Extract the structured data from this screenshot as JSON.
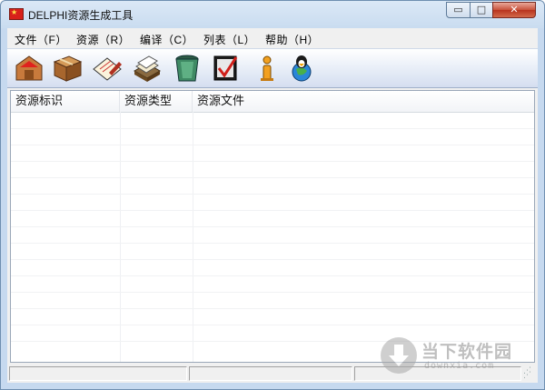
{
  "window": {
    "title": "DELPHI资源生成工具"
  },
  "controls": {
    "minimize": "▭",
    "maximize": "□",
    "close": "✕"
  },
  "menu": [
    {
      "label": "文件（F）"
    },
    {
      "label": "资源（R）"
    },
    {
      "label": "编译（C）"
    },
    {
      "label": "列表（L）"
    },
    {
      "label": "帮助（H）"
    }
  ],
  "toolbar": [
    {
      "icon": "house-box-icon"
    },
    {
      "icon": "cardboard-box-icon"
    },
    {
      "icon": "edit-card-icon"
    },
    {
      "icon": "card-file-icon"
    },
    {
      "icon": "recycle-bin-icon"
    },
    {
      "icon": "compile-check-icon"
    },
    {
      "icon": "info-icon"
    },
    {
      "icon": "penguin-globe-icon"
    }
  ],
  "list": {
    "columns": [
      "资源标识",
      "资源类型",
      "资源文件"
    ]
  },
  "watermark": {
    "title": "当下软件园",
    "sub": "downxia.com"
  }
}
